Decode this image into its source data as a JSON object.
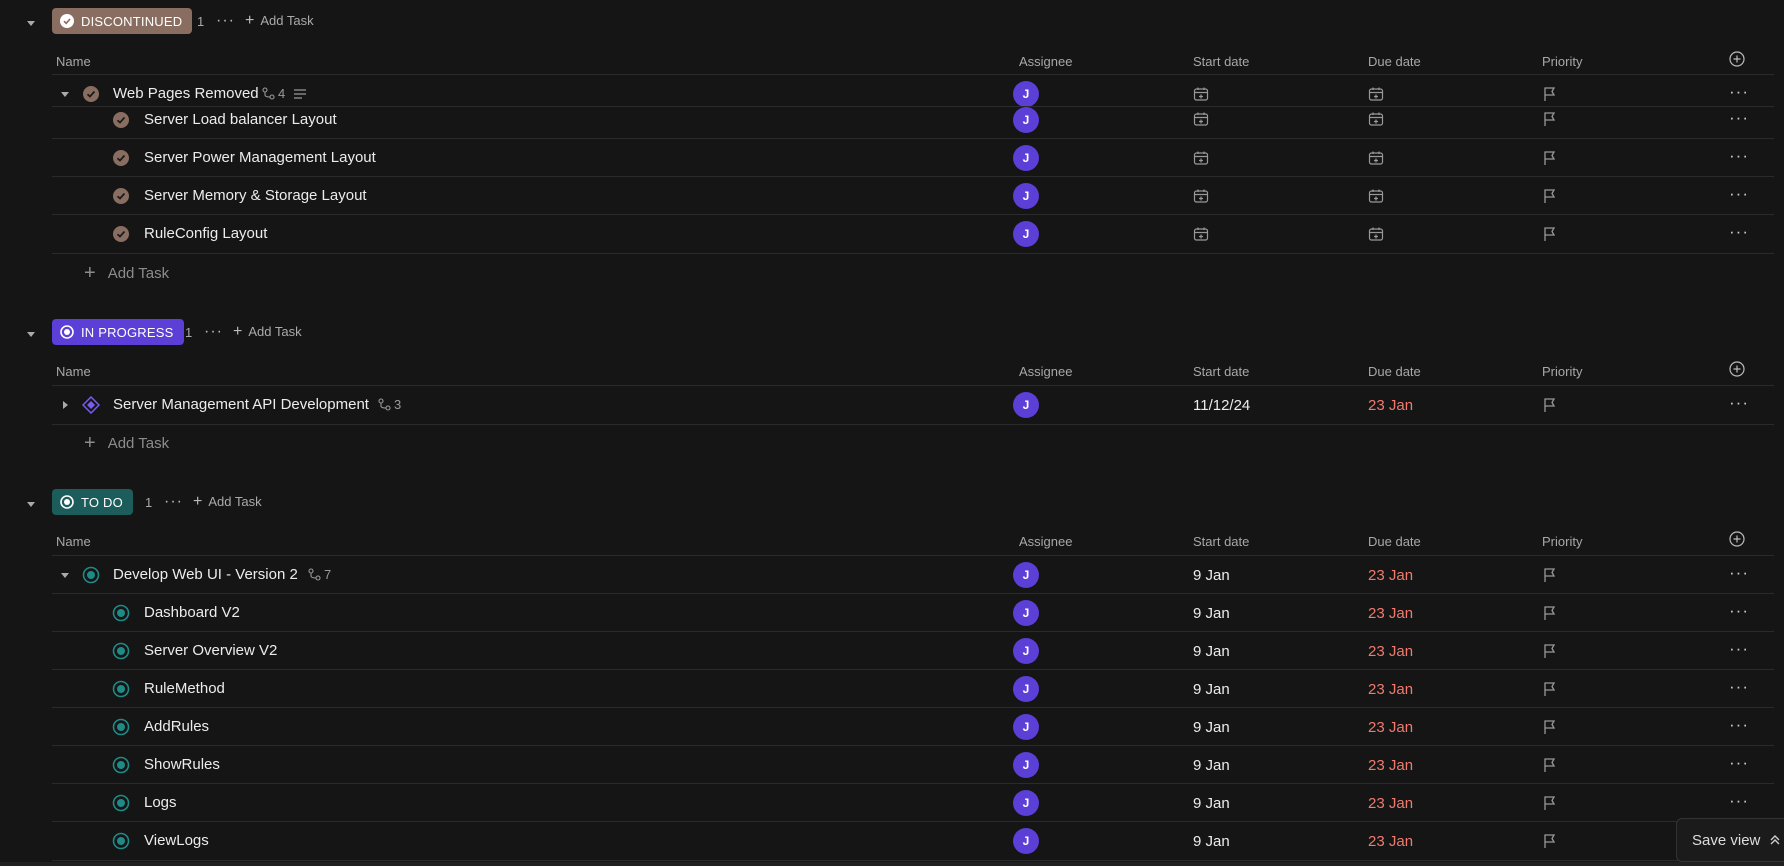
{
  "columns": {
    "name": "Name",
    "assignee": "Assignee",
    "start": "Start date",
    "due": "Due date",
    "priority": "Priority"
  },
  "add_task_label": "Add Task",
  "more_label": "···",
  "avatar_initial": "J",
  "groups": [
    {
      "status": "DISCONTINUED",
      "color": "#8a6d61",
      "count": "1",
      "tasks": [
        {
          "name": "Web Pages Removed",
          "subtasks": "4",
          "parent": true
        },
        {
          "name": "Server Load balancer Layout"
        },
        {
          "name": "Server Power Management Layout"
        },
        {
          "name": "Server Memory & Storage Layout"
        },
        {
          "name": "RuleConfig Layout"
        }
      ]
    },
    {
      "status": "IN PROGRESS",
      "color": "#5b3fd6",
      "count": "1",
      "tasks": [
        {
          "name": "Server Management API Development",
          "subtasks": "3",
          "start": "11/12/24",
          "due": "23 Jan",
          "parent": true
        }
      ]
    },
    {
      "status": "TO DO",
      "color": "#1c5c5a",
      "count": "1",
      "tasks": [
        {
          "name": "Develop Web UI - Version 2",
          "subtasks": "7",
          "start": "9 Jan",
          "due": "23 Jan",
          "parent": true
        },
        {
          "name": "Dashboard V2",
          "start": "9 Jan",
          "due": "23 Jan"
        },
        {
          "name": "Server Overview V2",
          "start": "9 Jan",
          "due": "23 Jan"
        },
        {
          "name": "RuleMethod",
          "start": "9 Jan",
          "due": "23 Jan"
        },
        {
          "name": "AddRules",
          "start": "9 Jan",
          "due": "23 Jan"
        },
        {
          "name": "ShowRules",
          "start": "9 Jan",
          "due": "23 Jan"
        },
        {
          "name": "Logs",
          "start": "9 Jan",
          "due": "23 Jan"
        },
        {
          "name": "ViewLogs",
          "start": "9 Jan",
          "due": "23 Jan"
        }
      ]
    }
  ],
  "save_view_label": "Save view"
}
